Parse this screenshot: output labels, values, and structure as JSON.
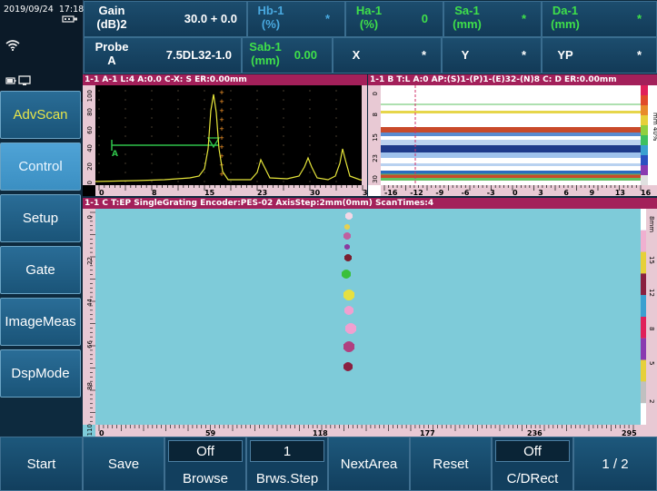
{
  "status": {
    "date": "2019/09/24",
    "time": "17:18"
  },
  "params": {
    "row1": [
      {
        "label": "Gain\n(dB)2",
        "value": "30.0 + 0.0",
        "label_color": "white"
      },
      {
        "label": "Hb-1\n(%)",
        "value": "*",
        "label_color": "dim"
      },
      {
        "label": "Ha-1\n(%)",
        "value": "0",
        "label_color": "green"
      },
      {
        "label": "Sa-1\n(mm)",
        "value": "*",
        "label_color": "green"
      },
      {
        "label": "Da-1\n(mm)",
        "value": "*",
        "label_color": "green"
      }
    ],
    "row2": [
      {
        "label": "Probe\nA",
        "value": "7.5DL32-1.0",
        "label_color": "white"
      },
      {
        "label": "Sab-1\n(mm)",
        "value": "0.00",
        "label_color": "green"
      },
      {
        "label": "X",
        "value": "*",
        "label_color": "white"
      },
      {
        "label": "Y",
        "value": "*",
        "label_color": "white"
      },
      {
        "label": "YP",
        "value": "*",
        "label_color": "white"
      }
    ]
  },
  "sidebar": {
    "items": [
      {
        "label": "AdvScan",
        "state": "highlight"
      },
      {
        "label": "Control",
        "state": "active"
      },
      {
        "label": "Setup",
        "state": "normal"
      },
      {
        "label": "Gate",
        "state": "normal"
      },
      {
        "label": "ImageMeas",
        "state": "normal"
      },
      {
        "label": "DspMode",
        "state": "normal"
      }
    ]
  },
  "ascan": {
    "header": "1-1 A-1  L:4  A:0.0  C-X: S   ER:0.00mm",
    "x_ticks": [
      "0",
      "8",
      "15",
      "23",
      "30",
      "38"
    ],
    "y_ticks": [
      "100",
      "80",
      "60",
      "40",
      "20",
      "0"
    ],
    "gate_label": "A"
  },
  "bscan": {
    "header": "1-1 B  T:L  A:0  AP:(S)1-(P)1-(E)32-(N)8  C: D   ER:0.00mm",
    "x_ticks": [
      "-16",
      "-12",
      "-9",
      "-6",
      "-3",
      "0",
      "3",
      "6",
      "9",
      "13",
      "16"
    ],
    "y_ticks": [
      "0",
      "8",
      "15",
      "23",
      "30"
    ],
    "side_label": "mm 40%"
  },
  "cscan": {
    "header": "1-1 C  T:EP   SingleGrating   Encoder:PES-02   AxisStep:2mm(0mm)   ScanTimes:4",
    "x_ticks": [
      "0",
      "59",
      "118",
      "177",
      "236",
      "295"
    ],
    "y_ticks": [
      "0",
      "22",
      "44",
      "66",
      "88",
      "110"
    ],
    "side_ticks": [
      "8mm",
      "15",
      "12",
      "8",
      "5",
      "2"
    ]
  },
  "bottom": {
    "start": "Start",
    "save": "Save",
    "browse_value": "Off",
    "browse_label": "Browse",
    "step_value": "1",
    "step_label": "Brws.Step",
    "next_area": "NextArea",
    "reset": "Reset",
    "cdrect_value": "Off",
    "cdrect_label": "C/DRect",
    "page": "1 / 2"
  },
  "colors": {
    "panel_header": "#a3205a",
    "cscan_bg": "#7ecbd9",
    "ascan_signal": "#e6e53a",
    "gate": "#2fc24a"
  }
}
